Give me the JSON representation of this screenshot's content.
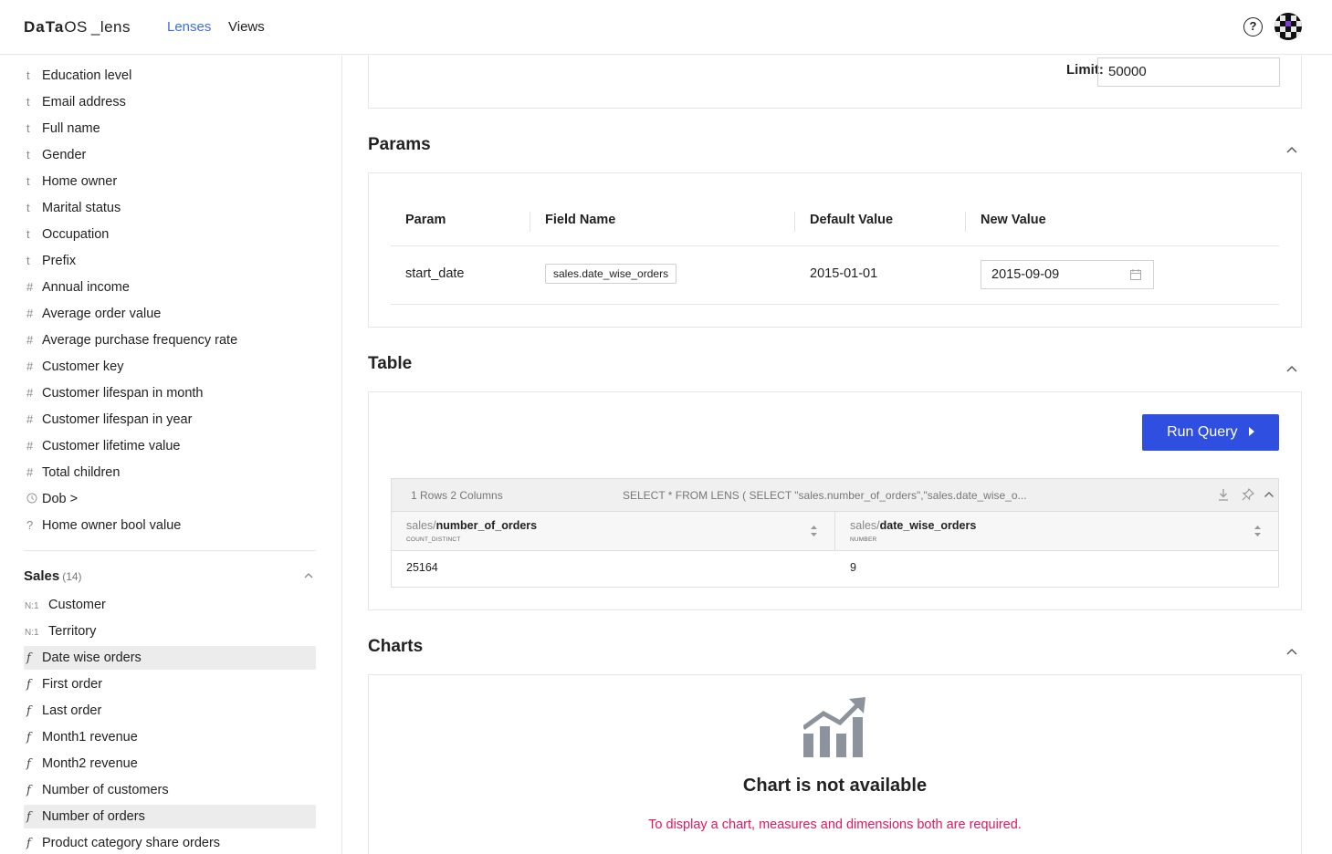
{
  "header": {
    "logo_bold": "DaTa",
    "logo_light": "OS",
    "logo_suffix": "_lens",
    "nav": [
      {
        "label": "Lenses",
        "active": true
      },
      {
        "label": "Views",
        "active": false
      }
    ],
    "help_glyph": "?",
    "accent_color": "#2f4fe0"
  },
  "sidebar": {
    "fields": [
      {
        "icon": "t",
        "label": "Education level"
      },
      {
        "icon": "t",
        "label": "Email address"
      },
      {
        "icon": "t",
        "label": "Full name"
      },
      {
        "icon": "t",
        "label": "Gender"
      },
      {
        "icon": "t",
        "label": "Home owner"
      },
      {
        "icon": "t",
        "label": "Marital status"
      },
      {
        "icon": "t",
        "label": "Occupation"
      },
      {
        "icon": "t",
        "label": "Prefix"
      },
      {
        "icon": "#",
        "label": "Annual income"
      },
      {
        "icon": "#",
        "label": "Average order value"
      },
      {
        "icon": "#",
        "label": "Average purchase frequency rate"
      },
      {
        "icon": "#",
        "label": "Customer key"
      },
      {
        "icon": "#",
        "label": "Customer lifespan in month"
      },
      {
        "icon": "#",
        "label": "Customer lifespan in year"
      },
      {
        "icon": "#",
        "label": "Customer lifetime value"
      },
      {
        "icon": "#",
        "label": "Total children"
      },
      {
        "icon": "clock",
        "label": "Dob >"
      },
      {
        "icon": "?",
        "label": "Home owner bool value"
      }
    ],
    "group": {
      "title": "Sales",
      "count": "(14)"
    },
    "group_fields": [
      {
        "icon": "N:1",
        "label": "Customer",
        "selected": false
      },
      {
        "icon": "N:1",
        "label": "Territory",
        "selected": false
      },
      {
        "icon": "f",
        "label": "Date wise orders",
        "selected": true
      },
      {
        "icon": "f",
        "label": "First order",
        "selected": false
      },
      {
        "icon": "f",
        "label": "Last order",
        "selected": false
      },
      {
        "icon": "f",
        "label": "Month1 revenue",
        "selected": false
      },
      {
        "icon": "f",
        "label": "Month2 revenue",
        "selected": false
      },
      {
        "icon": "f",
        "label": "Number of customers",
        "selected": false
      },
      {
        "icon": "f",
        "label": "Number of orders",
        "selected": true
      },
      {
        "icon": "f",
        "label": "Product category share orders",
        "selected": false
      }
    ]
  },
  "limit": {
    "label": "Limit:",
    "value": "50000"
  },
  "params": {
    "title": "Params",
    "headers": [
      "Param",
      "Field Name",
      "Default Value",
      "New Value"
    ],
    "row": {
      "param": "start_date",
      "field": "sales.date_wise_orders",
      "default": "2015-01-01",
      "new_value": "2015-09-09"
    }
  },
  "table": {
    "title": "Table",
    "run_label": "Run Query",
    "summary": "1 Rows 2 Columns",
    "query": "SELECT * FROM LENS ( SELECT \"sales.number_of_orders\",\"sales.date_wise_o...",
    "columns": [
      {
        "prefix": "sales/",
        "name": "number_of_orders",
        "type": "COUNT_DISTINCT"
      },
      {
        "prefix": "sales/",
        "name": "date_wise_orders",
        "type": "NUMBER"
      }
    ],
    "rows": [
      [
        "25164",
        "9"
      ]
    ]
  },
  "charts": {
    "title": "Charts",
    "empty_title": "Chart is not available",
    "empty_message": "To display a chart, measures and dimensions both are required.",
    "icon": "growth-chart-icon"
  }
}
